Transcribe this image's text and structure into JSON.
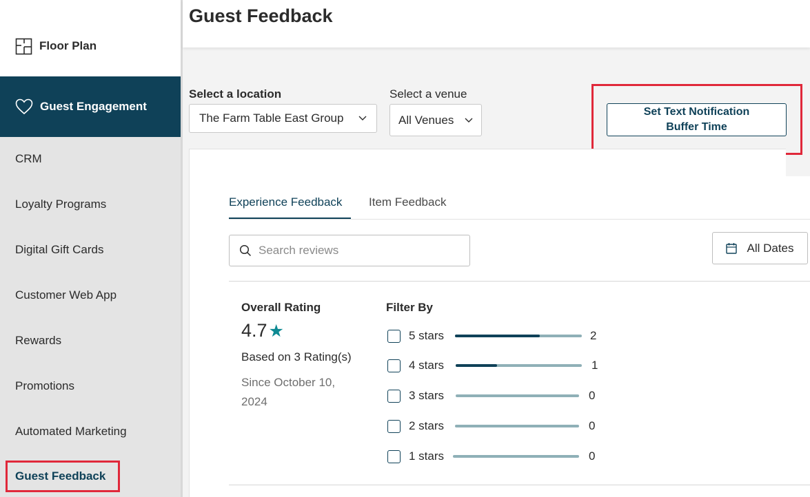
{
  "sidebar": {
    "floor_plan": "Floor Plan",
    "guest_engagement": "Guest Engagement",
    "items": [
      {
        "label": "CRM"
      },
      {
        "label": "Loyalty Programs"
      },
      {
        "label": "Digital Gift Cards"
      },
      {
        "label": "Customer Web App"
      },
      {
        "label": "Rewards"
      },
      {
        "label": "Promotions"
      },
      {
        "label": "Automated Marketing"
      }
    ],
    "active_item": "Guest Feedback"
  },
  "header": {
    "title": "Guest Feedback"
  },
  "filters": {
    "location_label": "Select a location",
    "location_value": "The Farm Table East Group",
    "venue_label": "Select a venue",
    "venue_value": "All Venues"
  },
  "notification_button": {
    "line1": "Set Text Notification",
    "line2": "Buffer Time"
  },
  "tabs": [
    {
      "label": "Experience Feedback",
      "active": true
    },
    {
      "label": "Item Feedback",
      "active": false
    }
  ],
  "search": {
    "placeholder": "Search reviews"
  },
  "dates_button": "All Dates",
  "rating": {
    "label": "Overall Rating",
    "value": "4.7",
    "star": "★",
    "based_on": "Based on 3 Rating(s)",
    "since": "Since October 10, 2024"
  },
  "filter_by": {
    "label": "Filter By",
    "rows": [
      {
        "label": "5 stars",
        "count": "2",
        "fill": 0.67
      },
      {
        "label": "4 stars",
        "count": "1",
        "fill": 0.33
      },
      {
        "label": "3 stars",
        "count": "0",
        "fill": 0
      },
      {
        "label": "2 stars",
        "count": "0",
        "fill": 0
      },
      {
        "label": "1 stars",
        "count": "0",
        "fill": 0
      }
    ]
  },
  "colors": {
    "brand": "#0f4158",
    "highlight": "#e0283a",
    "star": "#0e8a93",
    "bar_track": "#8fb0b7"
  }
}
